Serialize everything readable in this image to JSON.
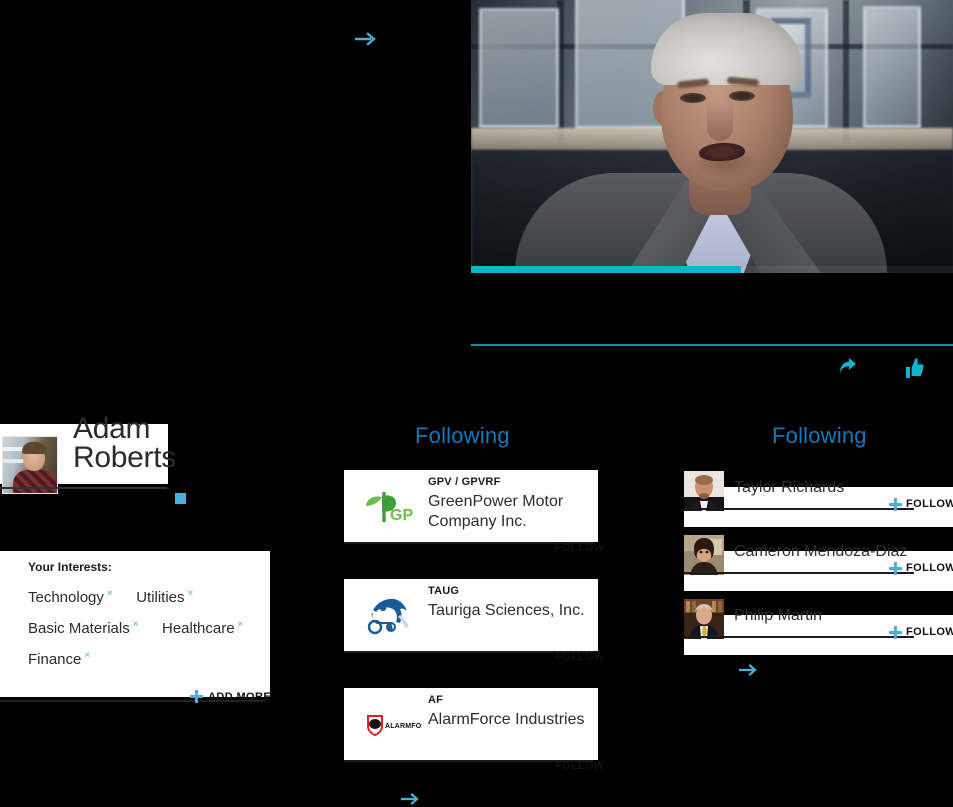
{
  "colors": {
    "accent_blue": "#4cafd9",
    "heading_blue": "#1479b8",
    "progress_teal": "#12b4cc",
    "divider_teal": "#1391a8",
    "card_bg": "#ffffff",
    "page_bg": "#000000"
  },
  "video": {
    "progress_percent": 56,
    "scrub_label": "video-progress"
  },
  "actions": {
    "share_label": "share-icon",
    "like_label": "thumbs-up-icon"
  },
  "profile": {
    "name_line1": "Adam",
    "name_line2": "Roberts",
    "avatar_label": "Adam Roberts profile photo"
  },
  "interests": {
    "title": "Your Interests:",
    "tags": [
      {
        "label": "Technology"
      },
      {
        "label": "Utilities"
      },
      {
        "label": "Basic Materials"
      },
      {
        "label": "Healthcare"
      },
      {
        "label": "Finance"
      }
    ],
    "remove_glyph": "×",
    "add_more_label": "ADD MORE"
  },
  "companies": {
    "heading": "Following",
    "follow_label": "FOLLOW",
    "items": [
      {
        "ticker": "GPV / GPVRF",
        "name": "GreenPower Motor Company Inc.",
        "logo": "greenpower-logo"
      },
      {
        "ticker": "TAUG",
        "name": "Tauriga Sciences, Inc.",
        "logo": "tauriga-logo"
      },
      {
        "ticker": "AF",
        "name": "AlarmForce Industries",
        "logo": "alarmforce-logo"
      }
    ]
  },
  "people": {
    "heading": "Following",
    "follow_label": "FOLLOW",
    "items": [
      {
        "name": "Taylor Richards"
      },
      {
        "name": "Cameron Mendoza-Diaz"
      },
      {
        "name": "Philip Martin"
      }
    ]
  },
  "nav": {
    "top_arrow": "arrow-right-icon",
    "companies_more_arrow": "arrow-right-icon",
    "people_more_arrow": "arrow-right-icon"
  }
}
